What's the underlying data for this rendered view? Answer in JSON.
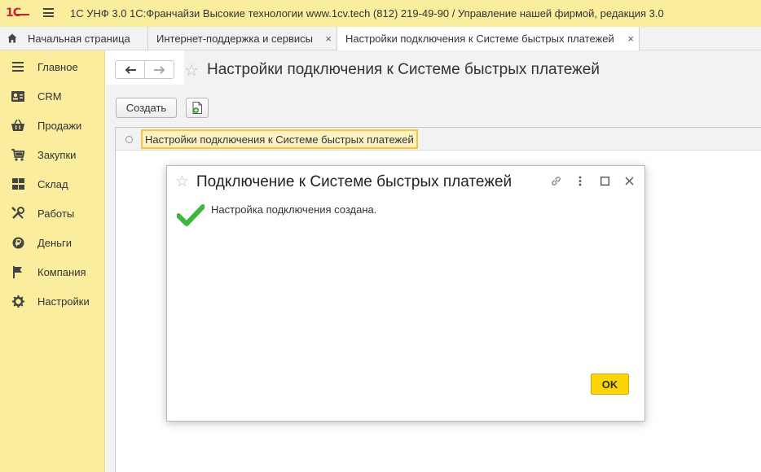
{
  "app": {
    "logo_text": "1С",
    "title": "1С УНФ 3.0 1С:Франчайзи Высокие технологии www.1cv.tech (812) 219-49-90 / Управление нашей фирмой, редакция 3.0"
  },
  "tabs": [
    {
      "label": "Начальная страница",
      "icon": "home-icon"
    },
    {
      "label": "Интернет-поддержка и сервисы",
      "close": "×"
    },
    {
      "label": "Настройки подключения к Системе быстрых платежей",
      "close": "×"
    }
  ],
  "sidebar": {
    "items": [
      {
        "label": "Главное",
        "icon": "menu-lines-icon"
      },
      {
        "label": "CRM",
        "icon": "contact-card-icon"
      },
      {
        "label": "Продажи",
        "icon": "basket-icon"
      },
      {
        "label": "Закупки",
        "icon": "cart-icon"
      },
      {
        "label": "Склад",
        "icon": "warehouse-grid-icon"
      },
      {
        "label": "Работы",
        "icon": "tools-icon"
      },
      {
        "label": "Деньги",
        "icon": "ruble-coin-icon"
      },
      {
        "label": "Компания",
        "icon": "flag-icon"
      },
      {
        "label": "Настройки",
        "icon": "gear-icon"
      }
    ]
  },
  "main": {
    "page_title": "Настройки подключения к Системе быстрых платежей",
    "create_label": "Создать",
    "list_rows": [
      {
        "name": "Настройки подключения к Системе быстрых платежей"
      }
    ]
  },
  "modal": {
    "title": "Подключение к Системе быстрых платежей",
    "message": "Настройка подключения создана.",
    "ok_label": "OK"
  },
  "colors": {
    "accent_yellow": "#fbed9e",
    "ok_button": "#fbd506",
    "logo_red": "#d3232a",
    "check_green": "#3cb63c"
  }
}
